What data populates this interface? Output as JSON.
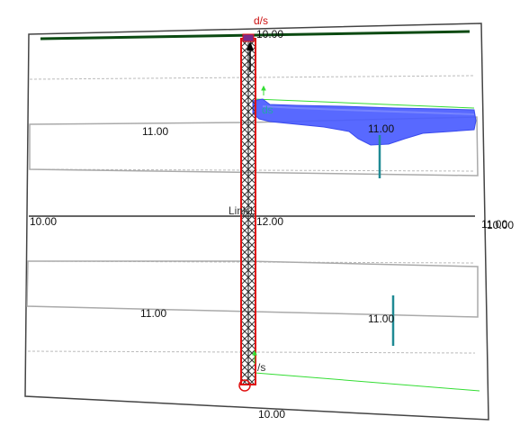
{
  "labels": {
    "top_center": "10.00",
    "bottom_center": "10.00",
    "left_mid": "10.00",
    "right_mid": "10.00",
    "right_mid_overlap": "11.00",
    "upper_left": "11.00",
    "upper_right": "11.00",
    "lower_left": "11.00",
    "lower_right": "11.00",
    "center": "12.00",
    "link_name": "Link1",
    "top_ds": "d/s",
    "mid_ds": "ds",
    "bottom_us": "/s"
  },
  "colors": {
    "frame": "#444444",
    "dark_green": "#0b4a12",
    "light_green": "#33dd33",
    "link_red": "#e01010",
    "link_fill": "#e8e8f4",
    "blue_fill": "#4a5cff",
    "teal": "#1f8a94",
    "gray_band": "#aaaaaa",
    "dashed": "#bbbbbb"
  }
}
